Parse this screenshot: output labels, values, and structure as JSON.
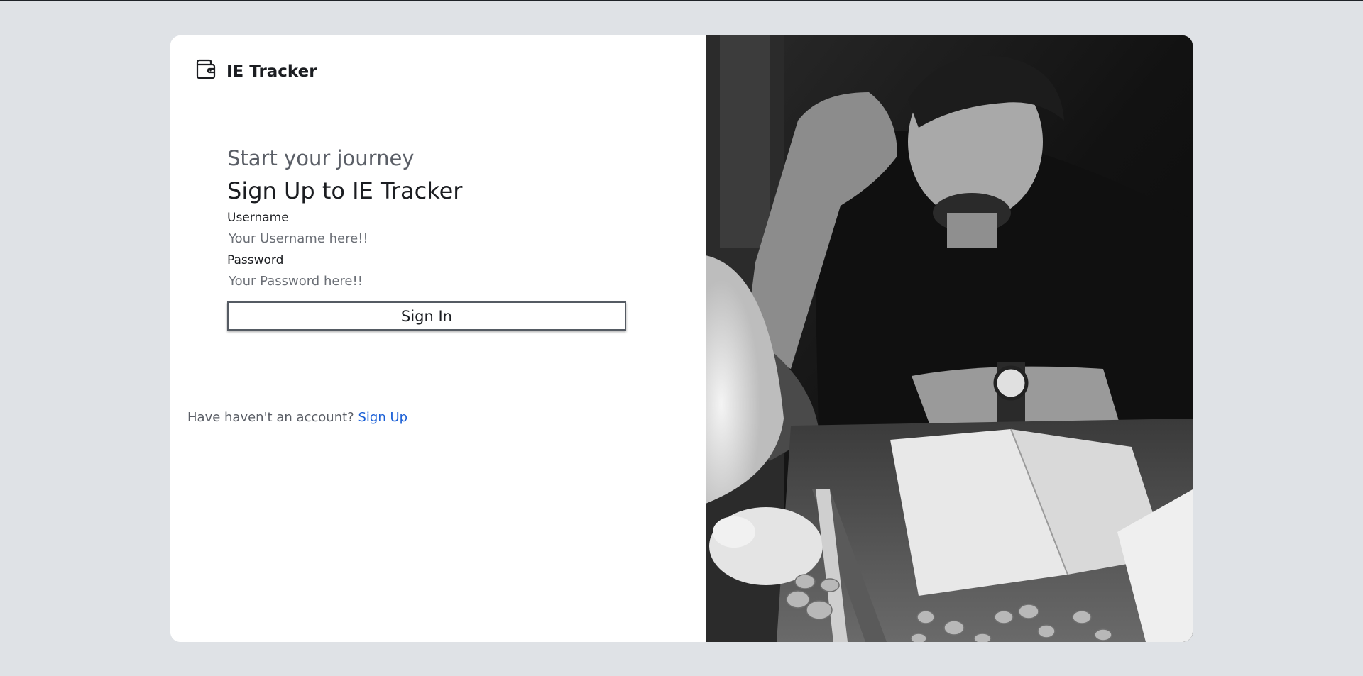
{
  "app": {
    "brand_name": "IE Tracker",
    "brand_icon": "wallet-icon"
  },
  "form": {
    "subtitle": "Start your journey",
    "title": "Sign Up to IE Tracker",
    "username_label": "Username",
    "username_placeholder": "Your Username here!!",
    "username_value": "",
    "password_label": "Password",
    "password_placeholder": "Your Password here!!",
    "password_value": "",
    "submit_label": "Sign In"
  },
  "footer": {
    "prompt": "Have haven't an account?",
    "link_label": "Sign Up"
  },
  "colors": {
    "page_background": "#dfe2e6",
    "card_background": "#ffffff",
    "link": "#1a5fd6",
    "button_border": "#555b63"
  },
  "hero": {
    "image": "black-and-white photo of a worried man at a desk with a notebook, a piggy bank and coins"
  }
}
